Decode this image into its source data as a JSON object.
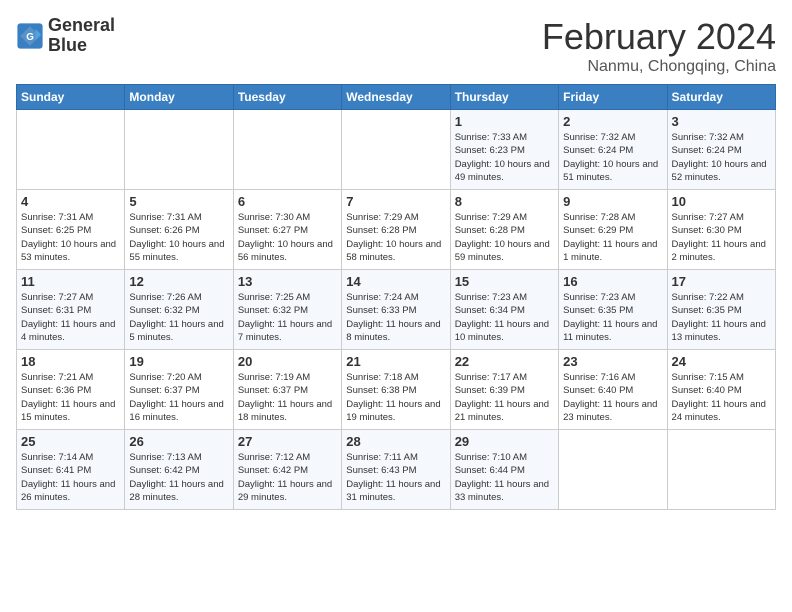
{
  "logo": {
    "line1": "General",
    "line2": "Blue"
  },
  "title": "February 2024",
  "subtitle": "Nanmu, Chongqing, China",
  "days_of_week": [
    "Sunday",
    "Monday",
    "Tuesday",
    "Wednesday",
    "Thursday",
    "Friday",
    "Saturday"
  ],
  "weeks": [
    [
      {
        "day": "",
        "info": ""
      },
      {
        "day": "",
        "info": ""
      },
      {
        "day": "",
        "info": ""
      },
      {
        "day": "",
        "info": ""
      },
      {
        "day": "1",
        "info": "Sunrise: 7:33 AM\nSunset: 6:23 PM\nDaylight: 10 hours and 49 minutes."
      },
      {
        "day": "2",
        "info": "Sunrise: 7:32 AM\nSunset: 6:24 PM\nDaylight: 10 hours and 51 minutes."
      },
      {
        "day": "3",
        "info": "Sunrise: 7:32 AM\nSunset: 6:24 PM\nDaylight: 10 hours and 52 minutes."
      }
    ],
    [
      {
        "day": "4",
        "info": "Sunrise: 7:31 AM\nSunset: 6:25 PM\nDaylight: 10 hours and 53 minutes."
      },
      {
        "day": "5",
        "info": "Sunrise: 7:31 AM\nSunset: 6:26 PM\nDaylight: 10 hours and 55 minutes."
      },
      {
        "day": "6",
        "info": "Sunrise: 7:30 AM\nSunset: 6:27 PM\nDaylight: 10 hours and 56 minutes."
      },
      {
        "day": "7",
        "info": "Sunrise: 7:29 AM\nSunset: 6:28 PM\nDaylight: 10 hours and 58 minutes."
      },
      {
        "day": "8",
        "info": "Sunrise: 7:29 AM\nSunset: 6:28 PM\nDaylight: 10 hours and 59 minutes."
      },
      {
        "day": "9",
        "info": "Sunrise: 7:28 AM\nSunset: 6:29 PM\nDaylight: 11 hours and 1 minute."
      },
      {
        "day": "10",
        "info": "Sunrise: 7:27 AM\nSunset: 6:30 PM\nDaylight: 11 hours and 2 minutes."
      }
    ],
    [
      {
        "day": "11",
        "info": "Sunrise: 7:27 AM\nSunset: 6:31 PM\nDaylight: 11 hours and 4 minutes."
      },
      {
        "day": "12",
        "info": "Sunrise: 7:26 AM\nSunset: 6:32 PM\nDaylight: 11 hours and 5 minutes."
      },
      {
        "day": "13",
        "info": "Sunrise: 7:25 AM\nSunset: 6:32 PM\nDaylight: 11 hours and 7 minutes."
      },
      {
        "day": "14",
        "info": "Sunrise: 7:24 AM\nSunset: 6:33 PM\nDaylight: 11 hours and 8 minutes."
      },
      {
        "day": "15",
        "info": "Sunrise: 7:23 AM\nSunset: 6:34 PM\nDaylight: 11 hours and 10 minutes."
      },
      {
        "day": "16",
        "info": "Sunrise: 7:23 AM\nSunset: 6:35 PM\nDaylight: 11 hours and 11 minutes."
      },
      {
        "day": "17",
        "info": "Sunrise: 7:22 AM\nSunset: 6:35 PM\nDaylight: 11 hours and 13 minutes."
      }
    ],
    [
      {
        "day": "18",
        "info": "Sunrise: 7:21 AM\nSunset: 6:36 PM\nDaylight: 11 hours and 15 minutes."
      },
      {
        "day": "19",
        "info": "Sunrise: 7:20 AM\nSunset: 6:37 PM\nDaylight: 11 hours and 16 minutes."
      },
      {
        "day": "20",
        "info": "Sunrise: 7:19 AM\nSunset: 6:37 PM\nDaylight: 11 hours and 18 minutes."
      },
      {
        "day": "21",
        "info": "Sunrise: 7:18 AM\nSunset: 6:38 PM\nDaylight: 11 hours and 19 minutes."
      },
      {
        "day": "22",
        "info": "Sunrise: 7:17 AM\nSunset: 6:39 PM\nDaylight: 11 hours and 21 minutes."
      },
      {
        "day": "23",
        "info": "Sunrise: 7:16 AM\nSunset: 6:40 PM\nDaylight: 11 hours and 23 minutes."
      },
      {
        "day": "24",
        "info": "Sunrise: 7:15 AM\nSunset: 6:40 PM\nDaylight: 11 hours and 24 minutes."
      }
    ],
    [
      {
        "day": "25",
        "info": "Sunrise: 7:14 AM\nSunset: 6:41 PM\nDaylight: 11 hours and 26 minutes."
      },
      {
        "day": "26",
        "info": "Sunrise: 7:13 AM\nSunset: 6:42 PM\nDaylight: 11 hours and 28 minutes."
      },
      {
        "day": "27",
        "info": "Sunrise: 7:12 AM\nSunset: 6:42 PM\nDaylight: 11 hours and 29 minutes."
      },
      {
        "day": "28",
        "info": "Sunrise: 7:11 AM\nSunset: 6:43 PM\nDaylight: 11 hours and 31 minutes."
      },
      {
        "day": "29",
        "info": "Sunrise: 7:10 AM\nSunset: 6:44 PM\nDaylight: 11 hours and 33 minutes."
      },
      {
        "day": "",
        "info": ""
      },
      {
        "day": "",
        "info": ""
      }
    ]
  ]
}
